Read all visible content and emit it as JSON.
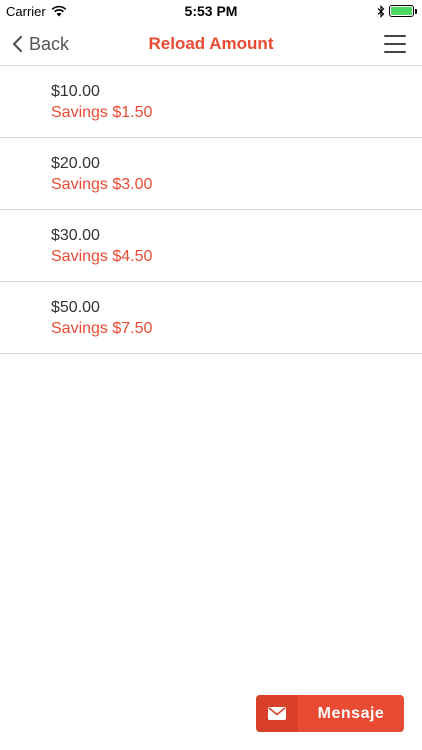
{
  "status_bar": {
    "carrier": "Carrier",
    "time": "5:53 PM"
  },
  "nav": {
    "back_label": "Back",
    "title": "Reload Amount"
  },
  "amounts": [
    {
      "value": "$10.00",
      "savings": "Savings $1.50"
    },
    {
      "value": "$20.00",
      "savings": "Savings $3.00"
    },
    {
      "value": "$30.00",
      "savings": "Savings $4.50"
    },
    {
      "value": "$50.00",
      "savings": "Savings $7.50"
    }
  ],
  "mensaje": {
    "label": "Mensaje"
  },
  "colors": {
    "accent": "#e84a32",
    "accent_dark": "#d9402a",
    "battery": "#4cd964"
  }
}
